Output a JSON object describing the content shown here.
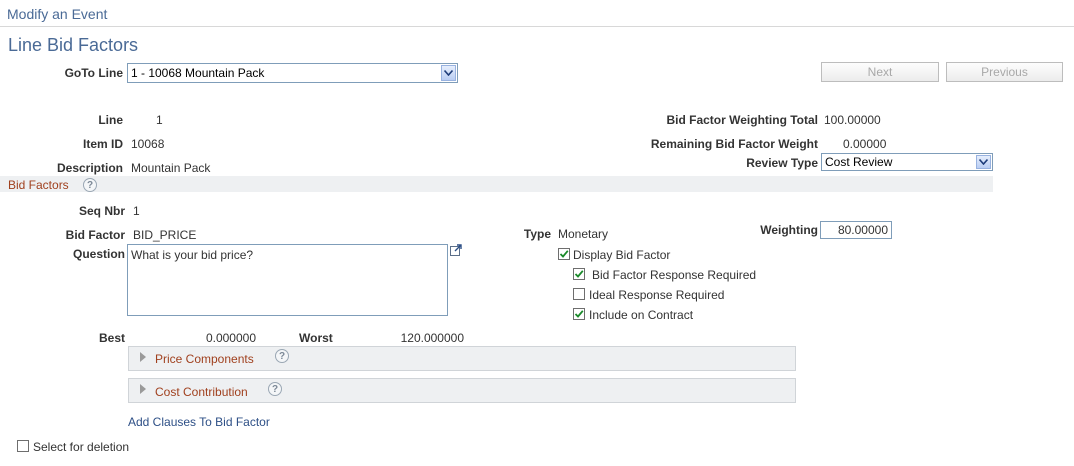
{
  "header": {
    "breadcrumb": "Modify an Event",
    "page_title": "Line Bid Factors"
  },
  "goto": {
    "label": "GoTo Line",
    "value": "1 - 10068 Mountain Pack"
  },
  "nav": {
    "next_label": "Next",
    "previous_label": "Previous"
  },
  "line_info": {
    "line_label": "Line",
    "line_value": "1",
    "item_label": "Item ID",
    "item_value": "10068",
    "desc_label": "Description",
    "desc_value": "Mountain Pack"
  },
  "weights": {
    "total_label": "Bid Factor Weighting Total",
    "total_value": "100.00000",
    "remaining_label": "Remaining Bid Factor Weight",
    "remaining_value": "0.00000",
    "review_label": "Review Type",
    "review_value": "Cost Review"
  },
  "bid_factors": {
    "section_title": "Bid Factors",
    "seq_label": "Seq Nbr",
    "seq_value": "1",
    "bf_label": "Bid Factor",
    "bf_value": "BID_PRICE",
    "type_label": "Type",
    "type_value": "Monetary",
    "weighting_label": "Weighting",
    "weighting_value": "80.00000",
    "question_label": "Question",
    "question_value": "What is your bid price?",
    "checkboxes": [
      {
        "label": "Display Bid Factor",
        "checked": true
      },
      {
        "label": "Bid Factor Response Required",
        "checked": true
      },
      {
        "label": "Ideal Response Required",
        "checked": false
      },
      {
        "label": "Include on Contract",
        "checked": true
      }
    ],
    "best_label": "Best",
    "best_value": "0.000000",
    "worst_label": "Worst",
    "worst_value": "120.000000",
    "price_components": "Price Components",
    "cost_contribution": "Cost Contribution",
    "add_clauses": "Add Clauses To Bid Factor"
  },
  "footer": {
    "select_delete": "Select for deletion"
  },
  "icons": {
    "help": "question-mark-icon",
    "expand": "expand-arrow-icon",
    "dropdown": "chevron-down-icon",
    "collapsed": "triangle-right-icon"
  },
  "colors": {
    "title": "#4a6a96",
    "section": "#a0401e",
    "link": "#2d4f86"
  }
}
